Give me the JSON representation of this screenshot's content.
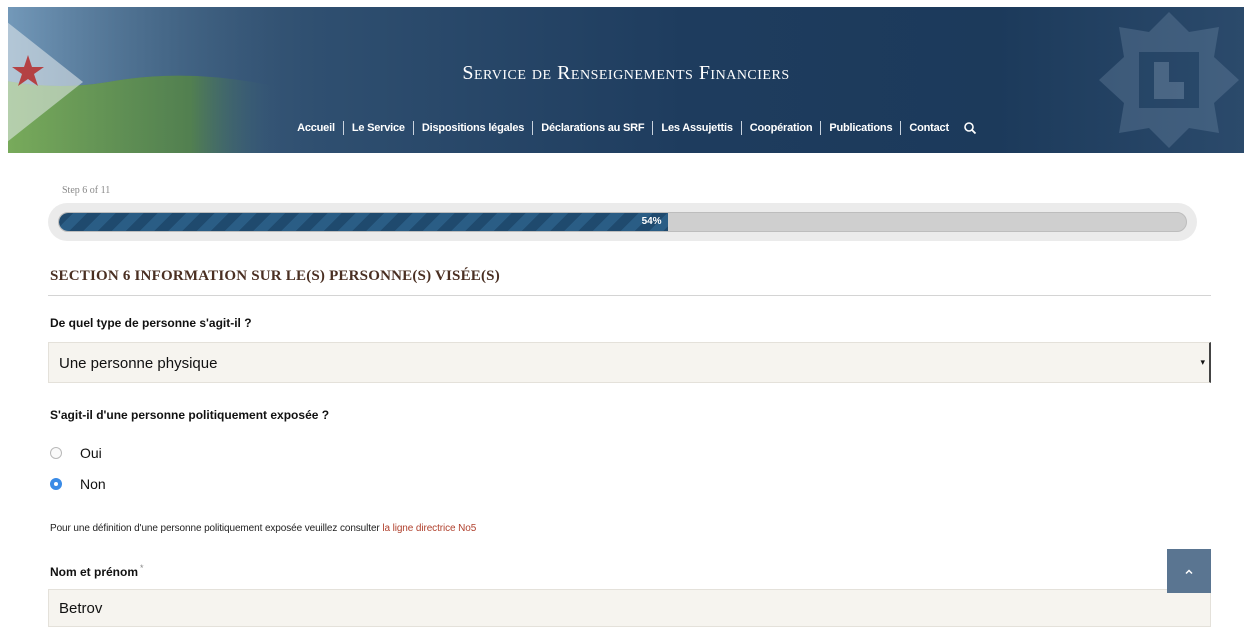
{
  "header": {
    "title": "Service de Renseignements Financiers",
    "nav": [
      {
        "label": "Accueil"
      },
      {
        "label": "Le Service"
      },
      {
        "label": "Dispositions légales"
      },
      {
        "label": "Déclarations au SRF"
      },
      {
        "label": "Les Assujettis"
      },
      {
        "label": "Coopération"
      },
      {
        "label": "Publications"
      },
      {
        "label": "Contact"
      }
    ],
    "search_icon": "search-icon"
  },
  "progress": {
    "step_label": "Step 6 of 11",
    "percent": 54,
    "percent_label": "54%"
  },
  "section": {
    "title": "SECTION 6 INFORMATION SUR LE(S) PERSONNE(S) VISÉE(S)",
    "person_type": {
      "label": "De quel type de personne s'agit-il ?",
      "selected": "Une personne physique"
    },
    "pep": {
      "label": "S'agit-il d'une personne politiquement exposée ?",
      "options": [
        {
          "label": "Oui",
          "checked": false
        },
        {
          "label": "Non",
          "checked": true
        }
      ],
      "help_text": "Pour une définition d'une personne politiquement exposée veuillez consulter ",
      "help_link": "la ligne directrice No5"
    },
    "name": {
      "label": "Nom et prénom",
      "required_mark": "*",
      "value": "Betrov"
    }
  },
  "colors": {
    "header_bg": "#1e3c5e",
    "progress_fill": "#1f4a6e",
    "section_title": "#4a2f22",
    "link": "#b0402d",
    "radio_checked": "#3a8be6",
    "back_to_top": "#5a7591"
  },
  "back_to_top_icon": "chevron-up-icon"
}
